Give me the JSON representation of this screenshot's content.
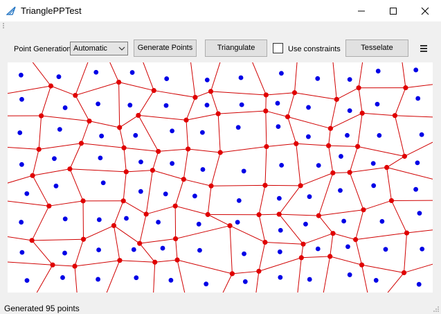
{
  "window": {
    "title": "TrianglePPTest"
  },
  "toolbar": {
    "point_generation_label": "Point Generation",
    "point_generation_value": "Automatic",
    "generate_points_label": "Generate Points",
    "triangulate_label": "Triangulate",
    "use_constraints_label": "Use constraints",
    "use_constraints_checked": false,
    "tesselate_label": "Tesselate"
  },
  "status": {
    "text": "Generated 95 points"
  },
  "colors": {
    "voronoi_edges": "#d00000",
    "voronoi_vertices": "#e00000",
    "input_points": "#0000e6"
  },
  "icons": [
    "triangle-app-icon",
    "minimize-icon",
    "maximize-icon",
    "close-icon",
    "chevron-down-icon",
    "menu-icon",
    "grip-icon",
    "size-grip-icon"
  ]
}
